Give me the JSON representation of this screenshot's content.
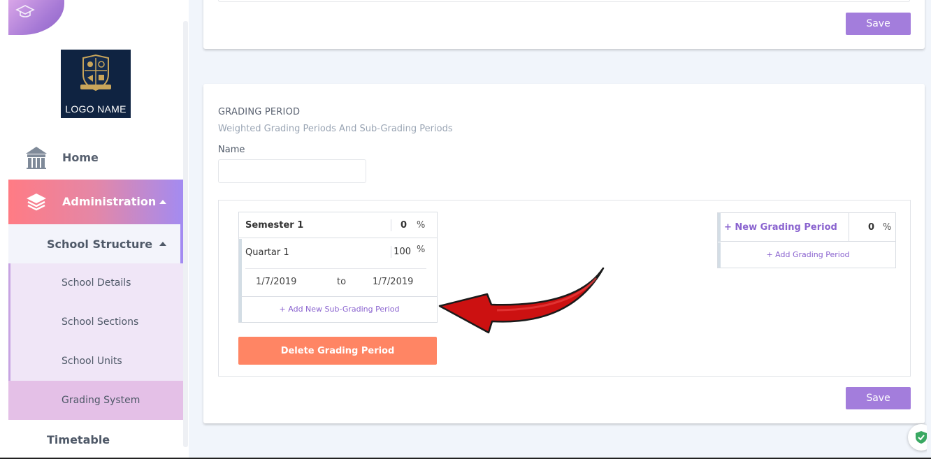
{
  "sidebar": {
    "brand_logo_text": "LOGO NAME",
    "home_label": "Home",
    "admin_label": "Administration",
    "school_structure_label": "School Structure",
    "sub_items": {
      "school_details": "School Details",
      "school_sections": "School Sections",
      "school_units": "School Units",
      "grading_system": "Grading System"
    },
    "timetable_label": "Timetable"
  },
  "top_card": {
    "save_label": "Save"
  },
  "grading_card": {
    "title": "GRADING PERIOD",
    "subtitle": "Weighted Grading Periods And Sub-Grading Periods",
    "name_label": "Name",
    "name_value": "",
    "semester": {
      "name": "Semester 1",
      "value": "0",
      "pct": "%"
    },
    "quarter": {
      "name": "Quartar 1",
      "value": "100",
      "pct": "%",
      "from": "1/7/2019",
      "to_label": "to",
      "until": "1/7/2019"
    },
    "add_sub_label": "+ Add New Sub-Grading Period",
    "delete_label": "Delete Grading Period",
    "new_grading": {
      "label": "+ New Grading Period",
      "value": "0",
      "pct": "%"
    },
    "add_grading_label": "+ Add Grading Period",
    "save_label": "Save"
  },
  "icons": {
    "home": "school-building-icon",
    "admin": "layers-icon",
    "corner": "graduation-cap-icon",
    "annotation": "red-arrow-icon",
    "security": "shield-check-icon"
  },
  "colors": {
    "accent_purple": "#a37ddc",
    "delete_orange": "#ff8564",
    "link_purple": "#8a63cf",
    "annotation_red": "#cc1111"
  }
}
